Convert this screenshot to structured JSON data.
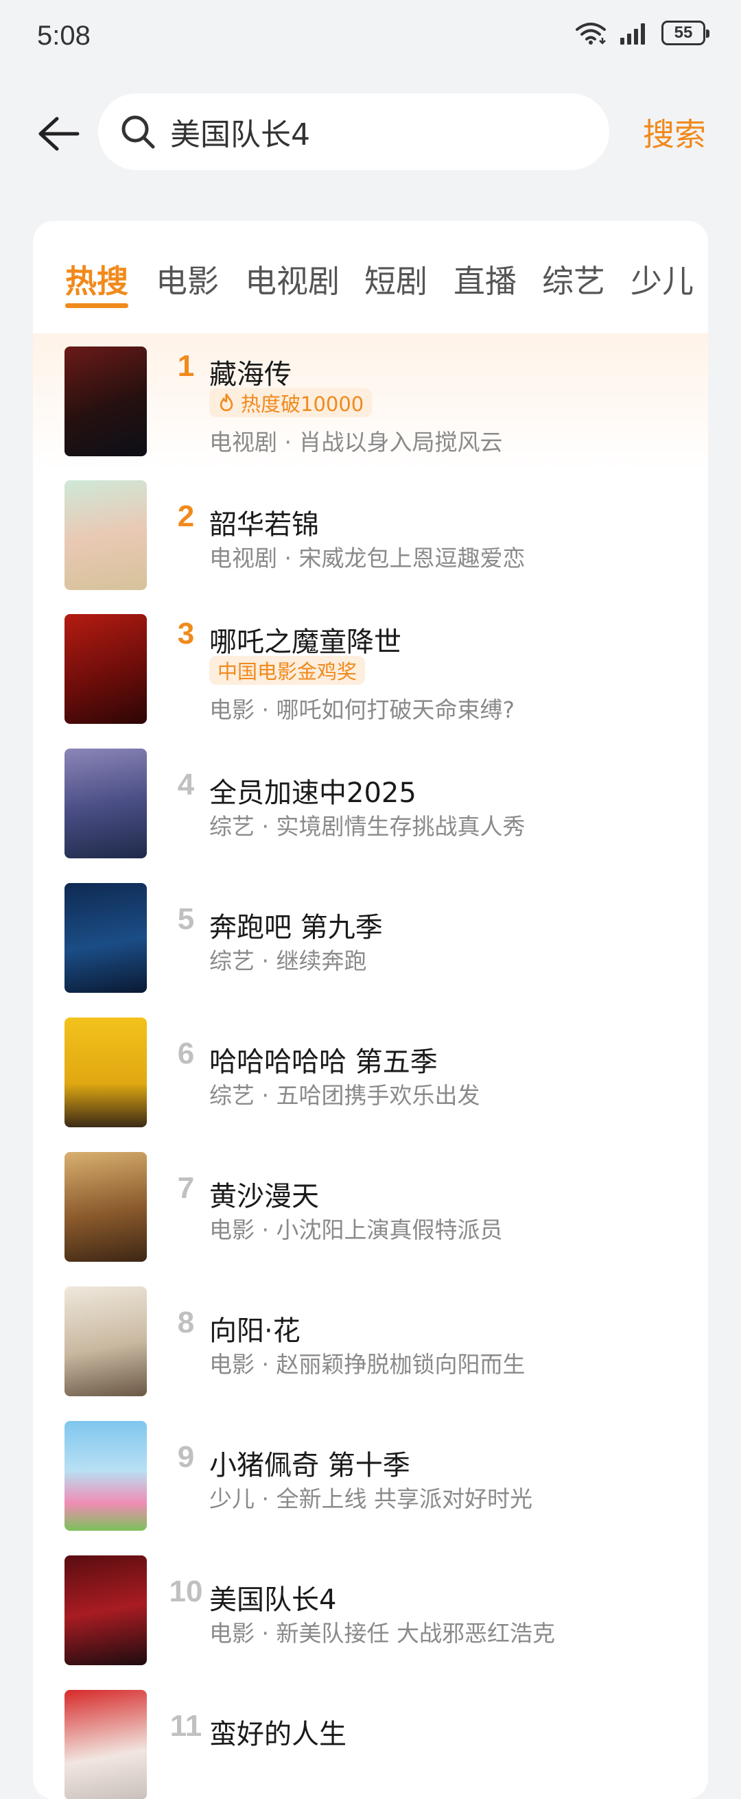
{
  "status_bar": {
    "time": "5:08",
    "battery": "55"
  },
  "search": {
    "query": "美国队长4",
    "button_label": "搜索"
  },
  "tabs": [
    {
      "label": "热搜",
      "active": true
    },
    {
      "label": "电影"
    },
    {
      "label": "电视剧"
    },
    {
      "label": "短剧"
    },
    {
      "label": "直播"
    },
    {
      "label": "综艺"
    },
    {
      "label": "少儿"
    }
  ],
  "items": [
    {
      "rank": "1",
      "title": "藏海传",
      "badge": "热度破10000",
      "desc": "电视剧 · 肖战以身入局搅风云"
    },
    {
      "rank": "2",
      "title": "韶华若锦",
      "desc": "电视剧 · 宋威龙包上恩逗趣爱恋"
    },
    {
      "rank": "3",
      "title": "哪吒之魔童降世",
      "badge": "中国电影金鸡奖",
      "desc": "电影 · 哪吒如何打破天命束缚?"
    },
    {
      "rank": "4",
      "title": "全员加速中2025",
      "desc": "综艺 · 实境剧情生存挑战真人秀"
    },
    {
      "rank": "5",
      "title": "奔跑吧 第九季",
      "desc": "综艺 · 继续奔跑"
    },
    {
      "rank": "6",
      "title": "哈哈哈哈哈 第五季",
      "desc": "综艺 · 五哈团携手欢乐出发"
    },
    {
      "rank": "7",
      "title": "黄沙漫天",
      "desc": "电影 · 小沈阳上演真假特派员"
    },
    {
      "rank": "8",
      "title": "向阳·花",
      "desc": "电影 · 赵丽颖挣脱枷锁向阳而生"
    },
    {
      "rank": "9",
      "title": "小猪佩奇 第十季",
      "desc": "少儿 · 全新上线 共享派对好时光"
    },
    {
      "rank": "10",
      "title": "美国队长4",
      "desc": "电影 · 新美队接任 大战邪恶红浩克"
    },
    {
      "rank": "11",
      "title": "蛮好的人生"
    }
  ],
  "colors": {
    "accent": "#f08a1c",
    "rank_gray": "#c0c0c0",
    "badge_bg": "#fdeede"
  }
}
